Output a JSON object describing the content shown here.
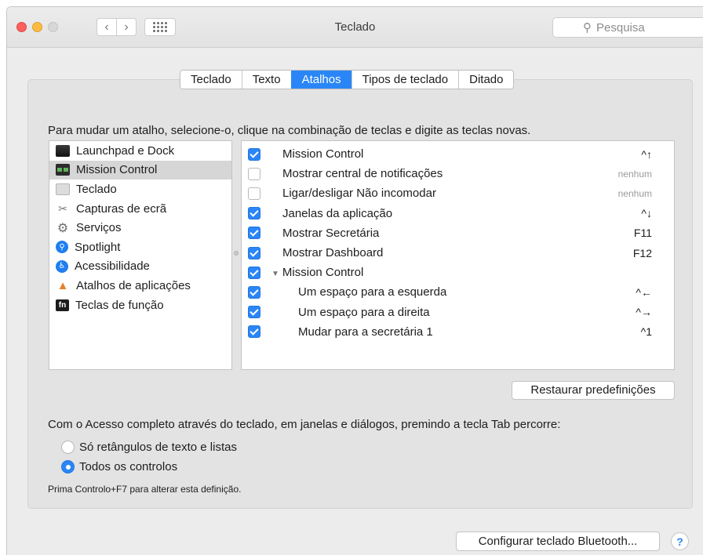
{
  "window": {
    "title": "Teclado"
  },
  "search": {
    "placeholder": "Pesquisa"
  },
  "tabs": [
    {
      "label": "Teclado",
      "active": false
    },
    {
      "label": "Texto",
      "active": false
    },
    {
      "label": "Atalhos",
      "active": true
    },
    {
      "label": "Tipos de teclado",
      "active": false
    },
    {
      "label": "Ditado",
      "active": false
    }
  ],
  "instruction": "Para mudar um atalho, selecione-o, clique na combinação de teclas e digite as teclas novas.",
  "categories": [
    {
      "label": "Launchpad e Dock",
      "icon": "launchpad-icon"
    },
    {
      "label": "Mission Control",
      "icon": "mission-control-icon",
      "selected": true
    },
    {
      "label": "Teclado",
      "icon": "keyboard-icon"
    },
    {
      "label": "Capturas de ecrã",
      "icon": "screenshot-icon"
    },
    {
      "label": "Serviços",
      "icon": "gear-icon"
    },
    {
      "label": "Spotlight",
      "icon": "spotlight-icon"
    },
    {
      "label": "Acessibilidade",
      "icon": "accessibility-icon"
    },
    {
      "label": "Atalhos de aplicações",
      "icon": "app-shortcuts-icon"
    },
    {
      "label": "Teclas de função",
      "icon": "fn-icon"
    }
  ],
  "shortcuts": [
    {
      "label": "Mission Control",
      "key": "^↑",
      "checked": true
    },
    {
      "label": "Mostrar central de notificações",
      "key": "nenhum",
      "checked": false
    },
    {
      "label": "Ligar/desligar Não incomodar",
      "key": "nenhum",
      "checked": false
    },
    {
      "label": "Janelas da aplicação",
      "key": "^↓",
      "checked": true
    },
    {
      "label": "Mostrar Secretária",
      "key": "F11",
      "checked": true
    },
    {
      "label": "Mostrar Dashboard",
      "key": "F12",
      "checked": true
    },
    {
      "label": "Mission Control",
      "key": "",
      "checked": true,
      "group": true
    },
    {
      "label": "Um espaço para a esquerda",
      "key": "^←",
      "checked": true,
      "indent": true
    },
    {
      "label": "Um espaço para a direita",
      "key": "^→",
      "checked": true,
      "indent": true
    },
    {
      "label": "Mudar para a secretária 1",
      "key": "^1",
      "checked": true,
      "indent": true
    }
  ],
  "restore_button": "Restaurar predefinições",
  "full_keyboard": {
    "text": "Com o Acesso completo através do teclado, em janelas e diálogos, premindo a tecla Tab percorre:",
    "option1": "Só retângulos de texto e listas",
    "option2": "Todos os controlos",
    "selected": "option2",
    "hint": "Prima Controlo+F7 para alterar esta definição."
  },
  "bluetooth_button": "Configurar teclado Bluetooth...",
  "help_label": "?"
}
